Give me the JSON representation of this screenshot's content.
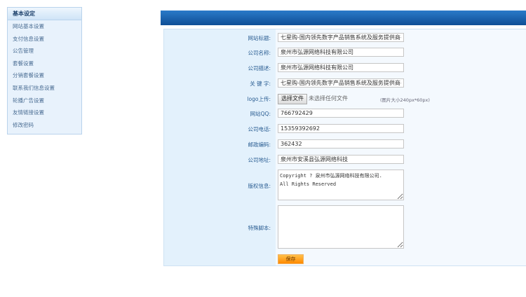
{
  "sidebar": {
    "title": "基本设定",
    "items": [
      "网站基本设置",
      "支付信息设置",
      "公告管理",
      "套餐设置",
      "分销套餐设置",
      "联系我们信息设置",
      "轮播广告设置",
      "友情链接设置",
      "修改密码"
    ]
  },
  "form": {
    "site_title": {
      "label": "网站标题:",
      "value": "七星购-国内领先数字产品销售系统及服务提供商-摇"
    },
    "company_name": {
      "label": "公司名称:",
      "value": "泉州市弘源网络科技有限公司"
    },
    "company_desc": {
      "label": "公司描述:",
      "value": "泉州市弘源网络科技有限公司"
    },
    "keywords": {
      "label": "关 键 字:",
      "value": "七星购-国内领先数字产品销售系统及服务提供商-摇"
    },
    "logo": {
      "label": "logo上传:",
      "button": "选择文件",
      "status": "未选择任何文件",
      "hint": "(图片大小240px*60px)"
    },
    "qq": {
      "label": "网站QQ:",
      "value": "766792429"
    },
    "phone": {
      "label": "公司电话:",
      "value": "15359392692"
    },
    "postcode": {
      "label": "邮政编码:",
      "value": "362432"
    },
    "address": {
      "label": "公司地址:",
      "value": "泉州市安溪县弘源网络科技"
    },
    "copyright": {
      "label": "版权信息:",
      "value": "Copyright ? 泉州市弘源网络科技有限公司.\nAll Rights Reserved"
    },
    "script": {
      "label": "特殊脚本:",
      "value": ""
    },
    "save_label": "保存"
  }
}
